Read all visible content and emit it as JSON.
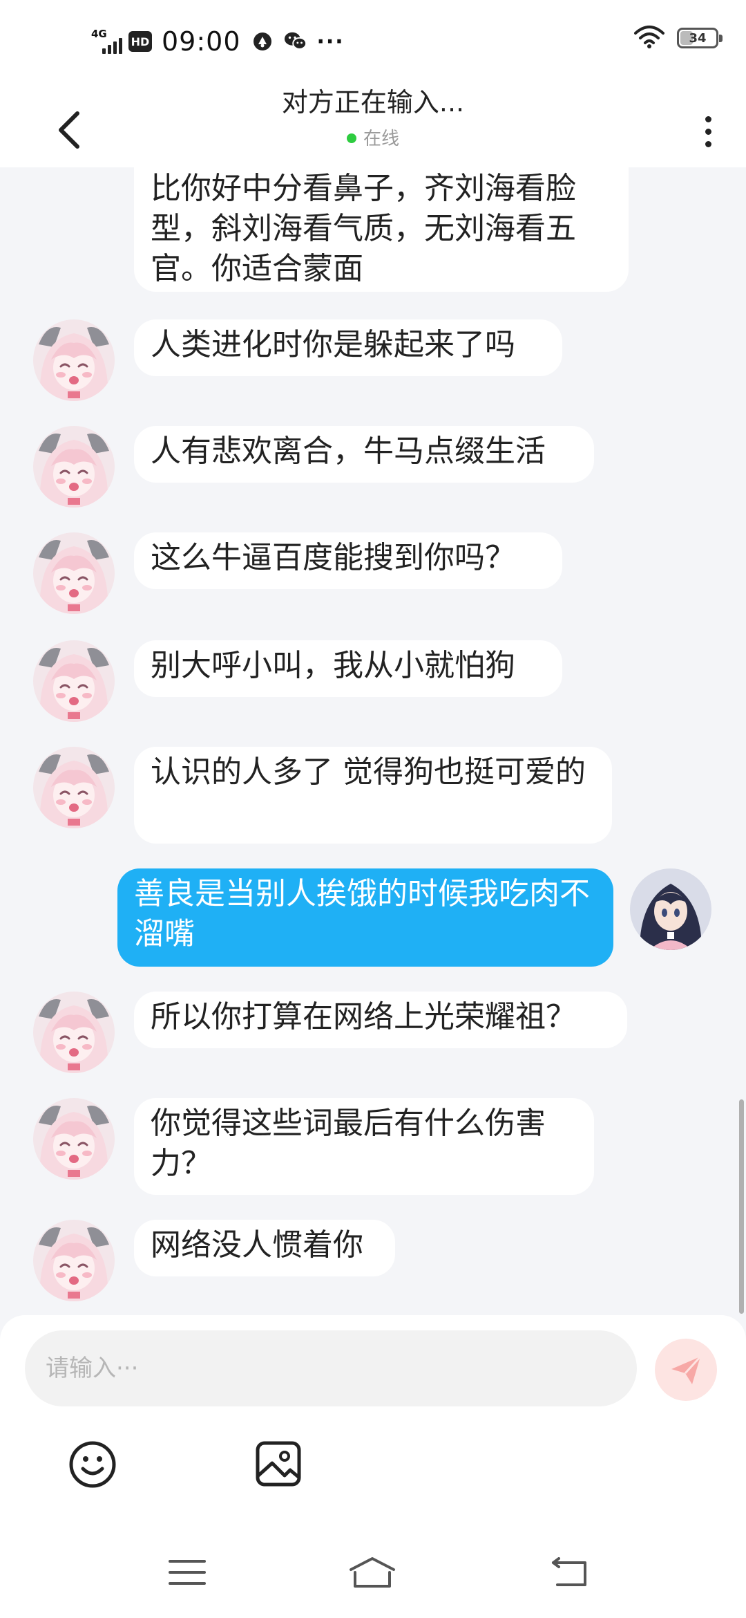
{
  "status_bar": {
    "network": "4G",
    "hd": "HD",
    "time": "09:00",
    "more": "···",
    "battery": "34"
  },
  "header": {
    "title": "对方正在输入...",
    "status": "在线"
  },
  "messages": [
    {
      "sender": "other",
      "text": "比你好中分看鼻子，齐刘海看脸型，斜刘海看气质，无刘海看五官。你适合蒙面"
    },
    {
      "sender": "other",
      "text": "人类进化时你是躲起来了吗"
    },
    {
      "sender": "other",
      "text": "人有悲欢离合，牛马点缀生活"
    },
    {
      "sender": "other",
      "text": "这么牛逼百度能搜到你吗？"
    },
    {
      "sender": "other",
      "text": "别大呼小叫，我从小就怕狗"
    },
    {
      "sender": "other",
      "text": "认识的人多了  觉得狗也挺可爱的"
    },
    {
      "sender": "me",
      "text": "善良是当别人挨饿的时候我吃肉不溜嘴"
    },
    {
      "sender": "other",
      "text": "所以你打算在网络上光荣耀祖？"
    },
    {
      "sender": "other",
      "text": "你觉得这些词最后有什么伤害力？"
    },
    {
      "sender": "other",
      "text": "网络没人惯着你"
    }
  ],
  "composer": {
    "placeholder": "请输入···",
    "value": ""
  },
  "colors": {
    "my_bubble": "#1fb0f5",
    "their_bubble": "#ffffff",
    "background": "#f4f5f8",
    "online_dot": "#2ecc40",
    "send_button": "#fde4e2"
  },
  "icons": [
    "back-arrow-icon",
    "more-vertical-icon",
    "send-icon",
    "emoji-icon",
    "image-icon",
    "menu-icon",
    "home-icon",
    "back-icon"
  ]
}
